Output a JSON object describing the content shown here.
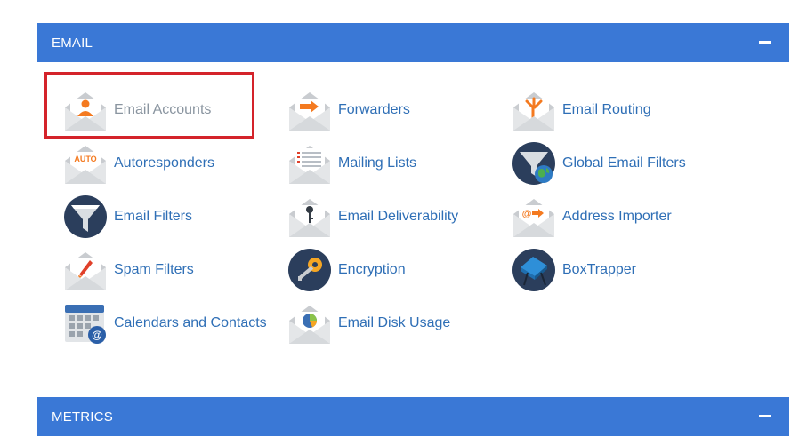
{
  "email_section": {
    "title": "EMAIL",
    "items": [
      {
        "label": "Email Accounts",
        "icon": "email-accounts-icon"
      },
      {
        "label": "Forwarders",
        "icon": "forwarders-icon"
      },
      {
        "label": "Email Routing",
        "icon": "email-routing-icon"
      },
      {
        "label": "Autoresponders",
        "icon": "autoresponders-icon",
        "icon_text": "AUTO"
      },
      {
        "label": "Mailing Lists",
        "icon": "mailing-lists-icon"
      },
      {
        "label": "Global Email Filters",
        "icon": "global-email-filters-icon"
      },
      {
        "label": "Email Filters",
        "icon": "email-filters-icon"
      },
      {
        "label": "Email Deliverability",
        "icon": "email-deliverability-icon"
      },
      {
        "label": "Address Importer",
        "icon": "address-importer-icon"
      },
      {
        "label": "Spam Filters",
        "icon": "spam-filters-icon"
      },
      {
        "label": "Encryption",
        "icon": "encryption-icon"
      },
      {
        "label": "BoxTrapper",
        "icon": "boxtrapper-icon"
      },
      {
        "label": "Calendars and Contacts",
        "icon": "calendars-contacts-icon"
      },
      {
        "label": "Email Disk Usage",
        "icon": "email-disk-usage-icon"
      }
    ]
  },
  "metrics_section": {
    "title": "METRICS"
  },
  "colors": {
    "header_bg": "#3a78d6",
    "link": "#2f6fb6",
    "muted_link": "#8a95a0",
    "highlight": "#d4232a",
    "accent_orange": "#f47a20"
  }
}
